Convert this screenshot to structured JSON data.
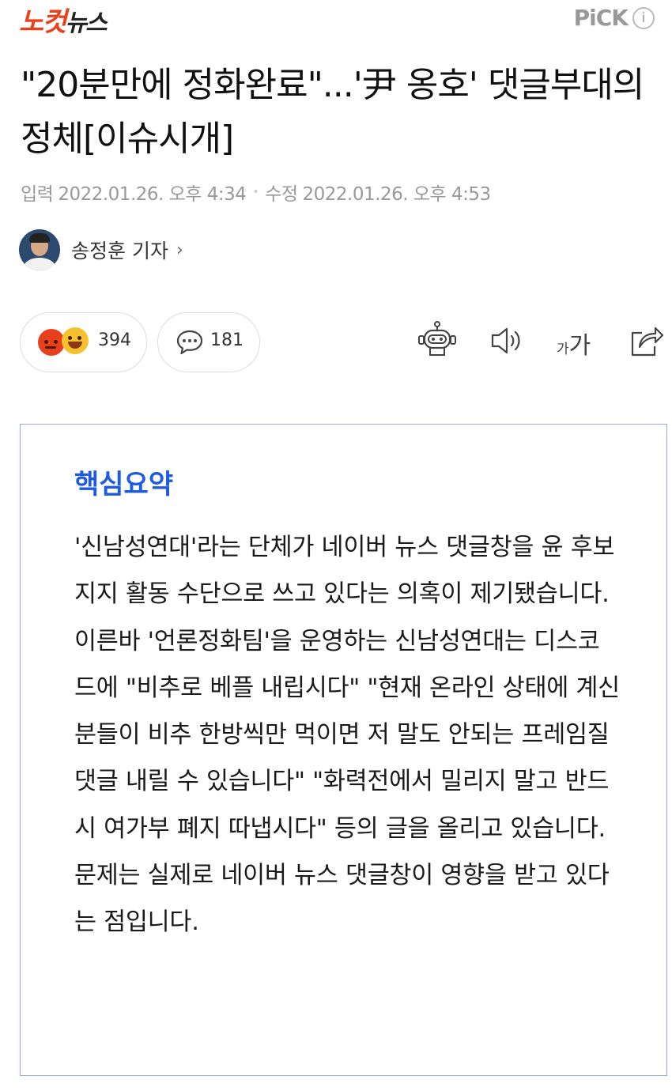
{
  "header": {
    "logo_part1": "노컷",
    "logo_part2": "뉴스",
    "pick_label": "PiCK",
    "info_glyph": "i"
  },
  "article": {
    "title": "\"20분만에 정화완료\"...'尹 옹호' 댓글부대의 정체[이슈시개]",
    "input_label": "입력",
    "input_date": "2022.01.26. 오후 4:34",
    "edit_label": "수정",
    "edit_date": "2022.01.26. 오후 4:53",
    "reporter": "송정훈 기자"
  },
  "actions": {
    "reaction_count": "394",
    "comment_count": "181",
    "font_size_small": "가",
    "font_size_large": "가",
    "icons": [
      "robot-summary-icon",
      "speaker-icon",
      "font-size-icon",
      "share-icon"
    ]
  },
  "summary": {
    "heading": "핵심요약",
    "body": "'신남성연대'라는 단체가 네이버 뉴스 댓글창을 윤 후보 지지 활동 수단으로 쓰고 있다는 의혹이 제기됐습니다. 이른바 '언론정화팀'을 운영하는 신남성연대는 디스코드에 \"비추로 베플 내립시다\" \"현재 온라인 상태에 계신 분들이 비추 한방씩만 먹이면 저 말도 안되는 프레임질 댓글 내릴 수 있습니다\" \"화력전에서 밀리지 말고 반드시 여가부 폐지 따냅시다\" 등의 글을 올리고 있습니다. 문제는 실제로 네이버 뉴스 댓글창이 영향을 받고 있다는 점입니다."
  },
  "colors": {
    "brand_red": "#e8411c",
    "summary_blue": "#1d5be0",
    "summary_border": "#8fa7e6"
  }
}
